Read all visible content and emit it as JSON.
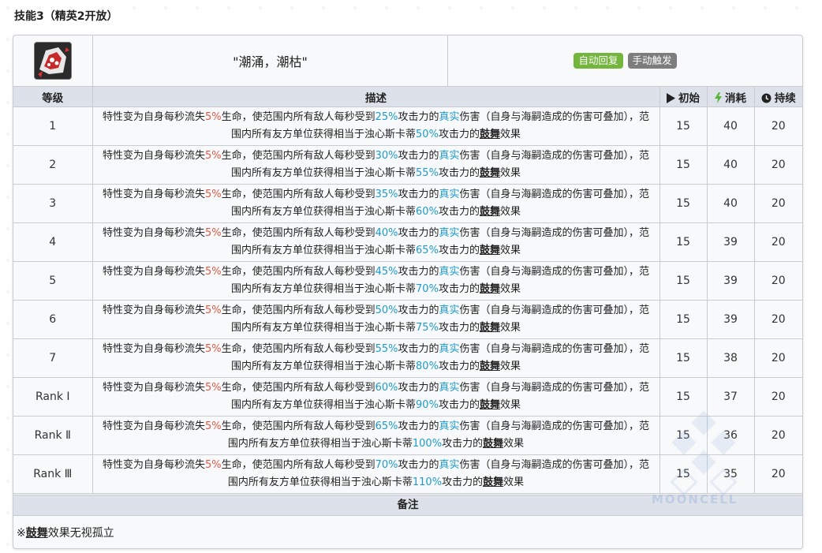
{
  "heading": "技能3（精英2开放）",
  "skill": {
    "name": "\"潮涌，潮枯\"",
    "tags": [
      "自动回复",
      "手动触发"
    ],
    "icon": "skill-tide-icon"
  },
  "table": {
    "headers": {
      "level": "等级",
      "desc": "描述",
      "initial": "初始",
      "cost": "消耗",
      "duration": "持续"
    },
    "header_icons": [
      "play-triangle-icon",
      "lightning-icon",
      "clock-icon"
    ],
    "rows": [
      {
        "level": "1",
        "d1": "特性变为自身每秒流失",
        "hp": "5%",
        "d2": "生命，使范围内所有敌人每秒受到",
        "atk": "25%",
        "d3": "攻击力的",
        "true": "真实",
        "d4": "伤害（自身与海嗣造成的伤害可叠加），范围内所有友方单位获得相当于浊心斯卡蒂",
        "buff": "50%",
        "d5": "攻击力的",
        "insp": "鼓舞",
        "d6": "效果",
        "initial": "15",
        "cost": "40",
        "duration": "20"
      },
      {
        "level": "2",
        "d1": "特性变为自身每秒流失",
        "hp": "5%",
        "d2": "生命，使范围内所有敌人每秒受到",
        "atk": "30%",
        "d3": "攻击力的",
        "true": "真实",
        "d4": "伤害（自身与海嗣造成的伤害可叠加），范围内所有友方单位获得相当于浊心斯卡蒂",
        "buff": "55%",
        "d5": "攻击力的",
        "insp": "鼓舞",
        "d6": "效果",
        "initial": "15",
        "cost": "40",
        "duration": "20"
      },
      {
        "level": "3",
        "d1": "特性变为自身每秒流失",
        "hp": "5%",
        "d2": "生命，使范围内所有敌人每秒受到",
        "atk": "35%",
        "d3": "攻击力的",
        "true": "真实",
        "d4": "伤害（自身与海嗣造成的伤害可叠加），范围内所有友方单位获得相当于浊心斯卡蒂",
        "buff": "60%",
        "d5": "攻击力的",
        "insp": "鼓舞",
        "d6": "效果",
        "initial": "15",
        "cost": "40",
        "duration": "20"
      },
      {
        "level": "4",
        "d1": "特性变为自身每秒流失",
        "hp": "5%",
        "d2": "生命，使范围内所有敌人每秒受到",
        "atk": "40%",
        "d3": "攻击力的",
        "true": "真实",
        "d4": "伤害（自身与海嗣造成的伤害可叠加），范围内所有友方单位获得相当于浊心斯卡蒂",
        "buff": "65%",
        "d5": "攻击力的",
        "insp": "鼓舞",
        "d6": "效果",
        "initial": "15",
        "cost": "39",
        "duration": "20"
      },
      {
        "level": "5",
        "d1": "特性变为自身每秒流失",
        "hp": "5%",
        "d2": "生命，使范围内所有敌人每秒受到",
        "atk": "45%",
        "d3": "攻击力的",
        "true": "真实",
        "d4": "伤害（自身与海嗣造成的伤害可叠加），范围内所有友方单位获得相当于浊心斯卡蒂",
        "buff": "70%",
        "d5": "攻击力的",
        "insp": "鼓舞",
        "d6": "效果",
        "initial": "15",
        "cost": "39",
        "duration": "20"
      },
      {
        "level": "6",
        "d1": "特性变为自身每秒流失",
        "hp": "5%",
        "d2": "生命，使范围内所有敌人每秒受到",
        "atk": "50%",
        "d3": "攻击力的",
        "true": "真实",
        "d4": "伤害（自身与海嗣造成的伤害可叠加），范围内所有友方单位获得相当于浊心斯卡蒂",
        "buff": "75%",
        "d5": "攻击力的",
        "insp": "鼓舞",
        "d6": "效果",
        "initial": "15",
        "cost": "39",
        "duration": "20"
      },
      {
        "level": "7",
        "d1": "特性变为自身每秒流失",
        "hp": "5%",
        "d2": "生命，使范围内所有敌人每秒受到",
        "atk": "55%",
        "d3": "攻击力的",
        "true": "真实",
        "d4": "伤害（自身与海嗣造成的伤害可叠加），范围内所有友方单位获得相当于浊心斯卡蒂",
        "buff": "80%",
        "d5": "攻击力的",
        "insp": "鼓舞",
        "d6": "效果",
        "initial": "15",
        "cost": "38",
        "duration": "20"
      },
      {
        "level": "Rank Ⅰ",
        "d1": "特性变为自身每秒流失",
        "hp": "5%",
        "d2": "生命，使范围内所有敌人每秒受到",
        "atk": "60%",
        "d3": "攻击力的",
        "true": "真实",
        "d4": "伤害（自身与海嗣造成的伤害可叠加），范围内所有友方单位获得相当于浊心斯卡蒂",
        "buff": "90%",
        "d5": "攻击力的",
        "insp": "鼓舞",
        "d6": "效果",
        "initial": "15",
        "cost": "37",
        "duration": "20"
      },
      {
        "level": "Rank Ⅱ",
        "d1": "特性变为自身每秒流失",
        "hp": "5%",
        "d2": "生命，使范围内所有敌人每秒受到",
        "atk": "65%",
        "d3": "攻击力的",
        "true": "真实",
        "d4": "伤害（自身与海嗣造成的伤害可叠加），范围内所有友方单位获得相当于浊心斯卡蒂",
        "buff": "100%",
        "d5": "攻击力的",
        "insp": "鼓舞",
        "d6": "效果",
        "initial": "15",
        "cost": "36",
        "duration": "20"
      },
      {
        "level": "Rank Ⅲ",
        "d1": "特性变为自身每秒流失",
        "hp": "5%",
        "d2": "生命，使范围内所有敌人每秒受到",
        "atk": "70%",
        "d3": "攻击力的",
        "true": "真实",
        "d4": "伤害（自身与海嗣造成的伤害可叠加），范围内所有友方单位获得相当于浊心斯卡蒂",
        "buff": "110%",
        "d5": "攻击力的",
        "insp": "鼓舞",
        "d6": "效果",
        "initial": "15",
        "cost": "35",
        "duration": "20"
      }
    ]
  },
  "remarks": {
    "title": "备注",
    "prefix": "※",
    "link": "鼓舞",
    "text": "效果无视孤立"
  },
  "watermark": "MOONCELL",
  "colors": {
    "hp": "#e05a47",
    "atk": "#1e9bc9",
    "tag_auto": "#74b53e",
    "tag_manual": "#7d7d7d"
  }
}
